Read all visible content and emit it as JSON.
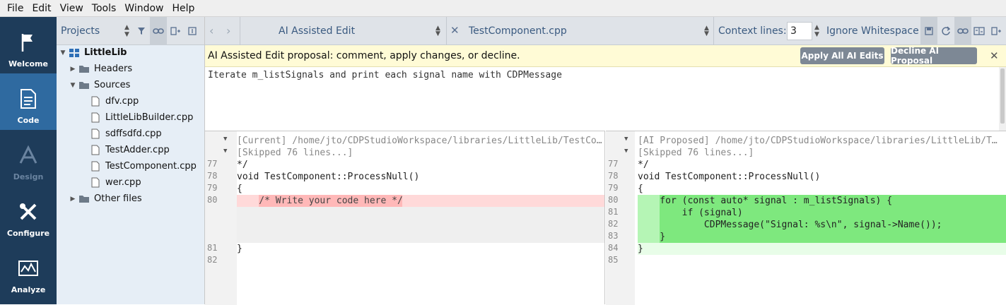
{
  "menu": [
    "File",
    "Edit",
    "View",
    "Tools",
    "Window",
    "Help"
  ],
  "modes": [
    {
      "label": "Welcome",
      "icon": "flag-icon",
      "state": "normal"
    },
    {
      "label": "Code",
      "icon": "document-icon",
      "state": "active"
    },
    {
      "label": "Design",
      "icon": "design-icon",
      "state": "disabled"
    },
    {
      "label": "Configure",
      "icon": "tools-icon",
      "state": "normal"
    },
    {
      "label": "Analyze",
      "icon": "chart-icon",
      "state": "normal"
    }
  ],
  "projects": {
    "title": "Projects",
    "root": "LittleLib",
    "headers": "Headers",
    "sources": "Sources",
    "files": [
      "dfv.cpp",
      "LittleLibBuilder.cpp",
      "sdffsdfd.cpp",
      "TestAdder.cpp",
      "TestComponent.cpp",
      "wer.cpp"
    ],
    "other": "Other files"
  },
  "editor": {
    "mode_label": "AI Assisted Edit",
    "file_label": "TestComponent.cpp",
    "context_label": "Context lines:",
    "context_value": "3",
    "ignore_ws": "Ignore Whitespace"
  },
  "banner": {
    "text": "AI Assisted Edit proposal: comment, apply changes, or decline.",
    "apply": "Apply All AI Edits",
    "decline": "Decline AI Proposal"
  },
  "prompt": "Iterate m_listSignals and print each signal name with CDPMessage",
  "left_pane": {
    "header": "[Current] /home/jto/CDPStudioWorkspace/libraries/LittleLib/TestCo…",
    "skipped": "[Skipped 76 lines...]",
    "lines": [
      {
        "n": "77",
        "t": "*/"
      },
      {
        "n": "78",
        "t": "void TestComponent::ProcessNull()"
      },
      {
        "n": "79",
        "t": "{"
      },
      {
        "n": "80",
        "t": "    /* Write your code here */"
      },
      {
        "n": "81",
        "t": "}"
      },
      {
        "n": "82",
        "t": ""
      }
    ]
  },
  "right_pane": {
    "header": "[AI Proposed] /home/jto/CDPStudioWorkspace/libraries/LittleLib/T…",
    "skipped": "[Skipped 76 lines...]",
    "lines": [
      {
        "n": "77",
        "t": "*/"
      },
      {
        "n": "78",
        "t": "void TestComponent::ProcessNull()"
      },
      {
        "n": "79",
        "t": "{"
      },
      {
        "n": "80",
        "t": "    for (const auto* signal : m_listSignals) {"
      },
      {
        "n": "81",
        "t": "        if (signal)"
      },
      {
        "n": "82",
        "t": "            CDPMessage(\"Signal: %s\\n\", signal->Name());"
      },
      {
        "n": "83",
        "t": "    }"
      },
      {
        "n": "84",
        "t": "}"
      },
      {
        "n": "85",
        "t": ""
      }
    ]
  },
  "colors": {
    "sidebar": "#1e3c5a",
    "active": "#2f6aa0",
    "removed": "#ffd9d9",
    "removed_strong": "#ffb8b8",
    "added": "#b5f5b5",
    "added_strong": "#7ee87e"
  }
}
